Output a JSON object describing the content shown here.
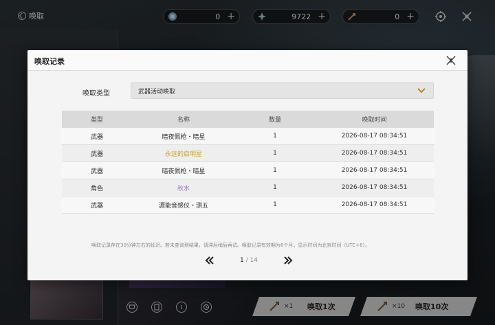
{
  "topbar": {
    "back_label": "唤取",
    "currencies": [
      {
        "icon": "orb-icon",
        "value": "0",
        "plus": "+"
      },
      {
        "icon": "star-icon",
        "value": "9722",
        "plus": "+"
      },
      {
        "icon": "arrow-ticket-icon",
        "value": "0",
        "plus": "+"
      }
    ]
  },
  "modal": {
    "title": "唤取记录",
    "filter_label": "唤取类型",
    "filter_value": "武器活动唤取",
    "columns": [
      "类型",
      "名称",
      "数量",
      "唤取时间"
    ],
    "rows": [
      {
        "type": "武器",
        "name": "暗夜佩枪・暗星",
        "qty": "1",
        "time": "2026-08-17 08:34:51",
        "name_color": "#333333"
      },
      {
        "type": "武器",
        "name": "永远的启明星",
        "qty": "1",
        "time": "2026-08-17 08:34:51",
        "name_color": "#c9a227"
      },
      {
        "type": "武器",
        "name": "暗夜佩枪・暗星",
        "qty": "1",
        "time": "2026-08-17 08:34:51",
        "name_color": "#333333"
      },
      {
        "type": "角色",
        "name": "秋水",
        "qty": "1",
        "time": "2026-08-17 08:34:51",
        "name_color": "#9a6fc4"
      },
      {
        "type": "武器",
        "name": "源能音感仪・测五",
        "qty": "1",
        "time": "2026-08-17 08:34:51",
        "name_color": "#333333"
      }
    ],
    "note": "唤取记录存在30分钟左右的延迟。若未查询到结果，请滞后稍后再试。唤取记录有效期为6个月，显示时间为北京时间（UTC+8）。",
    "pager": {
      "current": "1",
      "total": "/ 14"
    }
  },
  "bottom": {
    "pull_one": {
      "count": "×1",
      "label": "唤取1次"
    },
    "pull_ten": {
      "count": "×10",
      "label": "唤取10次"
    }
  },
  "colors": {
    "accent_gold": "#c9a227",
    "accent_purple": "#9a6fc4"
  }
}
